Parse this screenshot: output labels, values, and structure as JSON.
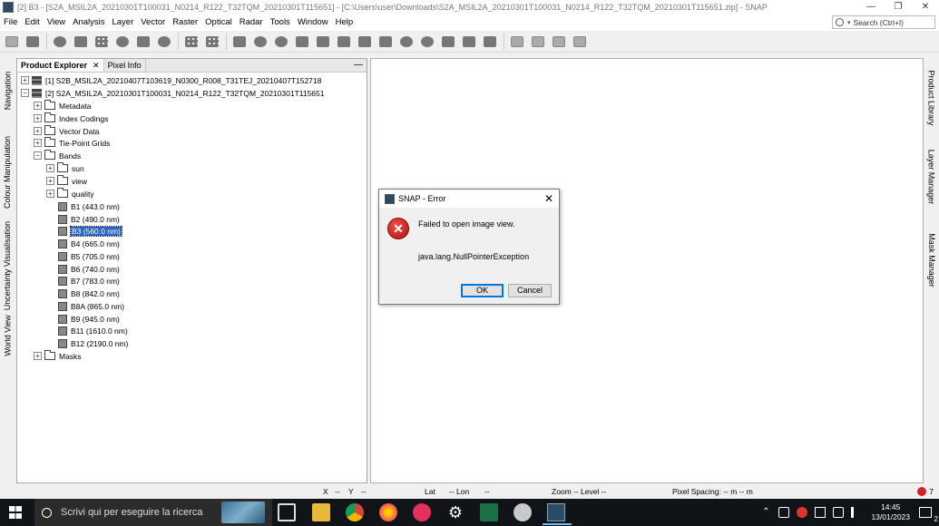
{
  "window": {
    "title": "[2] B3 - [S2A_MSIL2A_20210301T100031_N0214_R122_T32TQM_20210301T115651] - [C:\\Users\\user\\Downloads\\S2A_MSIL2A_20210301T100031_N0214_R122_T32TQM_20210301T115651.zip] - SNAP",
    "minimize": "—",
    "maximize": "❐",
    "close": "✕"
  },
  "menu": [
    "File",
    "Edit",
    "View",
    "Analysis",
    "Layer",
    "Vector",
    "Raster",
    "Optical",
    "Radar",
    "Tools",
    "Window",
    "Help"
  ],
  "search": {
    "placeholder": "Search (Ctrl+I)"
  },
  "toolbar": {
    "icons": [
      "open-product-icon",
      "save-product-icon",
      "band-maths-icon",
      "filtered-band-icon",
      "graticule-icon",
      "gcp-pin-icon",
      "magic-wand-icon",
      "gcp-manager-icon",
      "collocate-icon",
      "tie-point-icon",
      "select-tool-icon",
      "pan-tool-icon",
      "zoom-tool-icon",
      "pin-tool-icon",
      "gcp-tool-icon",
      "line-tool-icon",
      "polyline-tool-icon",
      "rectangle-tool-icon",
      "polygon-tool-icon",
      "ellipse-tool-icon",
      "range-finder-icon",
      "sync-cursor-icon",
      "measure-tool-icon",
      "tile-evenly-icon",
      "tile-horizontal-icon",
      "tile-vertical-icon",
      "tile-single-icon"
    ]
  },
  "left_strip": [
    "Navigation",
    "Colour Manipulation",
    "Uncertainty Visualisation",
    "World View"
  ],
  "right_strip": [
    "Product Library",
    "Layer Manager",
    "Mask Manager"
  ],
  "explorer": {
    "tabs": [
      "Product Explorer",
      "Pixel Info"
    ],
    "close_glyph": "✕",
    "minimize_glyph": "—",
    "products": [
      "[1] S2B_MSIL2A_20210407T103619_N0300_R008_T31TEJ_20210407T152718",
      "[2] S2A_MSIL2A_20210301T100031_N0214_R122_T32TQM_20210301T115651"
    ],
    "groups": [
      "Metadata",
      "Index Codings",
      "Vector Data",
      "Tie-Point Grids",
      "Bands",
      "Masks"
    ],
    "band_groups": [
      "sun",
      "view",
      "quality"
    ],
    "bands": [
      "B1 (443.0 nm)",
      "B2 (490.0 nm)",
      "B3 (560.0 nm)",
      "B4 (665.0 nm)",
      "B5 (705.0 nm)",
      "B6 (740.0 nm)",
      "B7 (783.0 nm)",
      "B8 (842.0 nm)",
      "B8A (865.0 nm)",
      "B9 (945.0 nm)",
      "B11 (1610.0 nm)",
      "B12 (2190.0 nm)"
    ],
    "selected_band": "B3 (560.0 nm)"
  },
  "dialog": {
    "title": "SNAP - Error",
    "message": "Failed to open image view.",
    "exception": "java.lang.NullPointerException",
    "ok_label": "OK",
    "cancel_label": "Cancel",
    "close_glyph": "✕",
    "error_glyph": "✕"
  },
  "statusbar": {
    "x": "X",
    "x_sep": "--",
    "y": "Y",
    "y_sep": "--",
    "lat": "Lat",
    "lon_label": "-- Lon",
    "lon_val": "--",
    "zoom": "Zoom --",
    "level": "Level --",
    "pixel_spacing": "Pixel Spacing: -- m -- m",
    "error_count": "7"
  },
  "taskbar": {
    "search_placeholder": "Scrivi qui per eseguire la ricerca",
    "time": "14:45",
    "date": "13/01/2023",
    "notification_count": "2",
    "tray_up": "⌃"
  },
  "colors": {
    "selection": "#2a63c6",
    "error_red": "#c41a1a",
    "taskbar": "#101418"
  }
}
